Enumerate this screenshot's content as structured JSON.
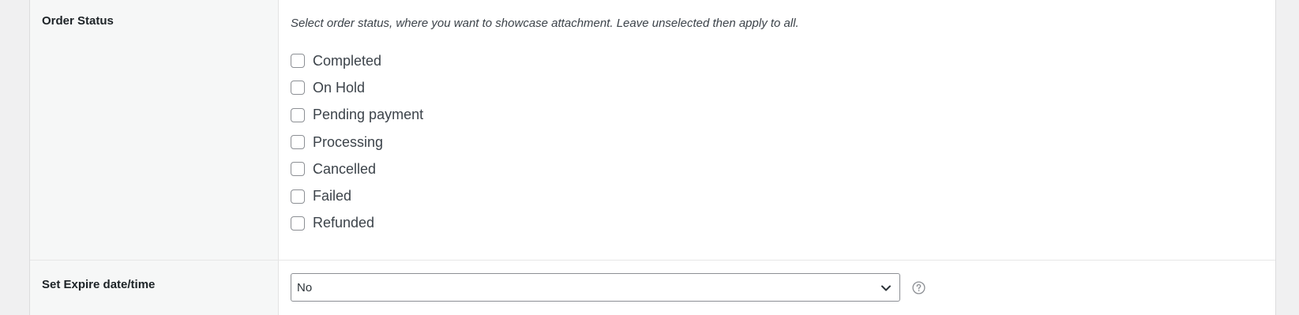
{
  "order_status": {
    "label": "Order Status",
    "description": "Select order status, where you want to showcase attachment. Leave unselected then apply to all.",
    "options": [
      {
        "label": "Completed",
        "checked": false
      },
      {
        "label": "On Hold",
        "checked": false
      },
      {
        "label": "Pending payment",
        "checked": false
      },
      {
        "label": "Processing",
        "checked": false
      },
      {
        "label": "Cancelled",
        "checked": false
      },
      {
        "label": "Failed",
        "checked": false
      },
      {
        "label": "Refunded",
        "checked": false
      }
    ]
  },
  "expire": {
    "label": "Set Expire date/time",
    "selected_value": "No",
    "help_icon": "question-circle-icon"
  },
  "colors": {
    "label_background": "#f6f7f7",
    "value_background": "#ffffff",
    "border": "#8c8f94"
  }
}
